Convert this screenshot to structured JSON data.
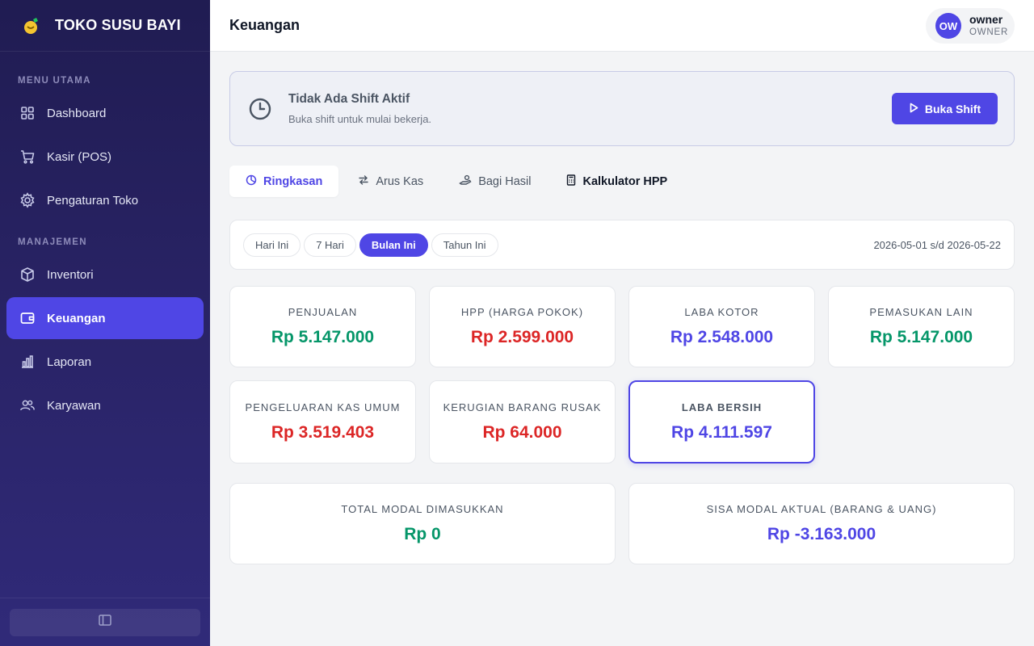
{
  "brand": {
    "name": "TOKO SUSU BAYI"
  },
  "sidebar": {
    "section_main": "MENU UTAMA",
    "section_manage": "MANAJEMEN",
    "items": [
      {
        "label": "Dashboard",
        "icon": "grid-icon"
      },
      {
        "label": "Kasir (POS)",
        "icon": "cart-icon"
      },
      {
        "label": "Pengaturan Toko",
        "icon": "gear-icon"
      },
      {
        "label": "Inventori",
        "icon": "box-icon"
      },
      {
        "label": "Keuangan",
        "icon": "wallet-icon",
        "active": true
      },
      {
        "label": "Laporan",
        "icon": "bar-chart-icon"
      },
      {
        "label": "Karyawan",
        "icon": "users-icon"
      }
    ]
  },
  "header": {
    "title": "Keuangan",
    "user": {
      "initials": "OW",
      "name": "owner",
      "role": "OWNER"
    }
  },
  "shift": {
    "title": "Tidak Ada Shift Aktif",
    "subtitle": "Buka shift untuk mulai bekerja.",
    "button": "Buka Shift"
  },
  "tabs": [
    {
      "label": "Ringkasan",
      "active": true
    },
    {
      "label": "Arus Kas"
    },
    {
      "label": "Bagi Hasil"
    },
    {
      "label": "Kalkulator HPP"
    }
  ],
  "filters": {
    "options": [
      "Hari Ini",
      "7 Hari",
      "Bulan Ini",
      "Tahun Ini"
    ],
    "selected": "Bulan Ini",
    "date_range": "2026-05-01 s/d 2026-05-22"
  },
  "cards": [
    {
      "label": "PENJUALAN",
      "value": "Rp 5.147.000",
      "tone": "green"
    },
    {
      "label": "HPP (HARGA POKOK)",
      "value": "Rp 2.599.000",
      "tone": "red"
    },
    {
      "label": "LABA KOTOR",
      "value": "Rp 2.548.000",
      "tone": "indigo"
    },
    {
      "label": "PEMASUKAN LAIN",
      "value": "Rp 5.147.000",
      "tone": "green"
    },
    {
      "label": "PENGELUARAN KAS UMUM",
      "value": "Rp 3.519.403",
      "tone": "red"
    },
    {
      "label": "KERUGIAN BARANG RUSAK",
      "value": "Rp 64.000",
      "tone": "red"
    },
    {
      "label": "LABA BERSIH",
      "value": "Rp 4.111.597",
      "tone": "indigo"
    }
  ],
  "modal_cards": [
    {
      "label": "TOTAL MODAL DIMASUKKAN",
      "value": "Rp 0",
      "tone": "green"
    },
    {
      "label": "SISA MODAL AKTUAL (BARANG & UANG)",
      "value": "Rp -3.163.000",
      "tone": "indigo"
    }
  ],
  "colors": {
    "primary": "#4f46e5",
    "positive": "#059669",
    "negative": "#dc2626",
    "sidebar": "#231f5c"
  }
}
